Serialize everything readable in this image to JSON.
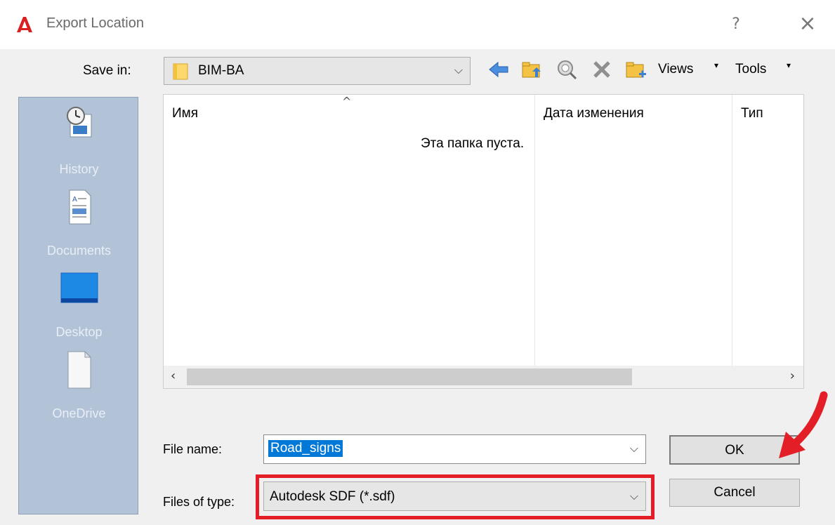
{
  "window": {
    "title": "Export Location",
    "help_glyph": "?",
    "close_glyph": "×"
  },
  "toolbar": {
    "save_in_label": "Save in:",
    "save_in_value": "BIM-BA",
    "views_label": "Views",
    "tools_label": "Tools",
    "icons": [
      "back-arrow-icon",
      "up-folder-icon",
      "search-web-icon",
      "delete-icon",
      "new-folder-icon"
    ]
  },
  "places": [
    {
      "label": "History",
      "icon": "history-icon"
    },
    {
      "label": "Documents",
      "icon": "documents-icon"
    },
    {
      "label": "Desktop",
      "icon": "desktop-icon"
    },
    {
      "label": "OneDrive",
      "icon": "onedrive-icon"
    }
  ],
  "filelist": {
    "columns": [
      "Имя",
      "Дата изменения",
      "Тип"
    ],
    "empty_message": "Эта папка пуста.",
    "scroll_left": "‹",
    "scroll_right": "›"
  },
  "file_name": {
    "label": "File name:",
    "value": "Road_signs"
  },
  "file_type": {
    "label": "Files of type:",
    "value": "Autodesk SDF  (*.sdf)"
  },
  "buttons": {
    "ok": "OK",
    "cancel": "Cancel"
  },
  "colors": {
    "highlight_box": "#e41e26",
    "selection": "#0078d7",
    "places_bg": "#b3c3d7"
  }
}
